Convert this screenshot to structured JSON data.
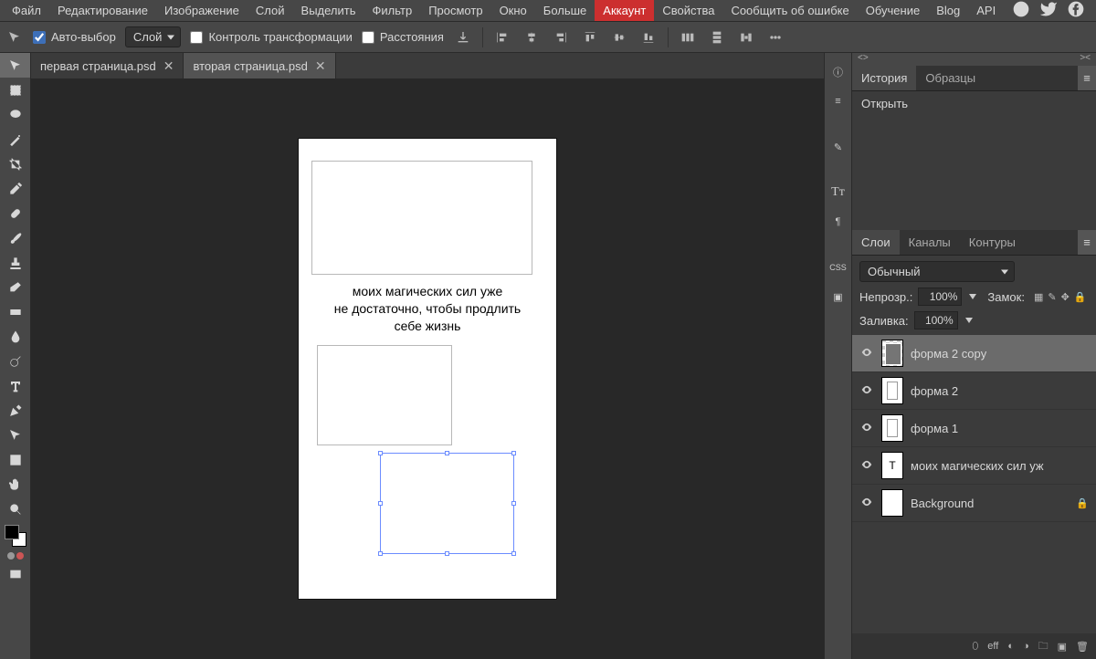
{
  "menu": {
    "items": [
      "Файл",
      "Редактирование",
      "Изображение",
      "Слой",
      "Выделить",
      "Фильтр",
      "Просмотр",
      "Окно",
      "Больше"
    ],
    "account": "Аккаунт",
    "right_items": [
      "Свойства",
      "Сообщить об ошибке",
      "Обучение",
      "Blog",
      "API"
    ]
  },
  "options": {
    "auto_select": "Авто-выбор",
    "scope": "Слой",
    "transform_controls": "Контроль трансформации",
    "distances": "Расстояния"
  },
  "tabs": [
    {
      "name": "первая страница.psd",
      "active": false
    },
    {
      "name": "вторая страница.psd",
      "active": true
    }
  ],
  "canvas": {
    "text_line1": "моих магических сил уже",
    "text_line2": "не достаточно, чтобы продлить",
    "text_line3": "себе жизнь"
  },
  "history_panel": {
    "tab1": "История",
    "tab2": "Образцы",
    "item1": "Открыть"
  },
  "layers_panel": {
    "tab1": "Слои",
    "tab2": "Каналы",
    "tab3": "Контуры",
    "blend_mode": "Обычный",
    "opacity_label": "Непрозр.:",
    "opacity_value": "100%",
    "lock_label": "Замок:",
    "fill_label": "Заливка:",
    "fill_value": "100%",
    "layers": [
      {
        "name": "форма 2 copy",
        "type": "shape",
        "selected": true
      },
      {
        "name": "форма 2",
        "type": "shape",
        "selected": false
      },
      {
        "name": "форма 1",
        "type": "shape",
        "selected": false
      },
      {
        "name": "моих магических сил уж",
        "type": "text",
        "selected": false
      },
      {
        "name": "Background",
        "type": "bg",
        "selected": false
      }
    ],
    "footer_eff": "eff"
  }
}
